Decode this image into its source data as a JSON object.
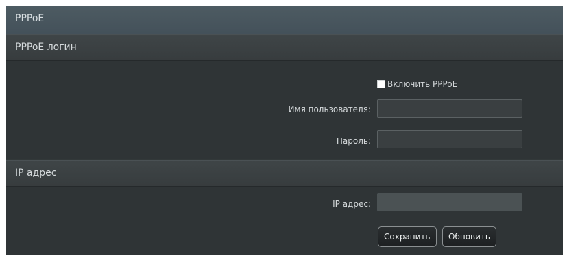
{
  "panel": {
    "title": "PPPoE"
  },
  "pppoe_login": {
    "title": "PPPoE логин",
    "enable_label": "Включить PPPoE",
    "enable_checked": false,
    "username_label": "Имя пользователя:",
    "username_value": "",
    "password_label": "Пароль:",
    "password_value": ""
  },
  "ip_section": {
    "title": "IP адрес",
    "ip_label": "IP адрес:",
    "ip_value": ""
  },
  "actions": {
    "save_label": "Сохранить",
    "refresh_label": "Обновить"
  }
}
